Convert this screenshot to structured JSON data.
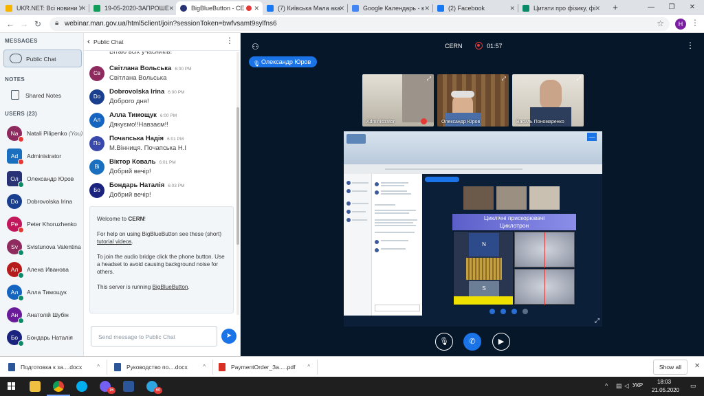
{
  "browser": {
    "tabs": [
      {
        "label": "UKR.NET: Всі новини У",
        "color": "#f4b400"
      },
      {
        "label": "19-05-2020-ЗАПРОШЕ",
        "color": "#0f9d58"
      },
      {
        "label": "BigBlueButton - CE",
        "color": "#283274"
      },
      {
        "label": "(7) Київська Мала ака",
        "color": "#1877f2"
      },
      {
        "label": "Google Календарь - к",
        "color": "#4285f4"
      },
      {
        "label": "(2) Facebook",
        "color": "#1877f2"
      },
      {
        "label": "Цитати про фізику, фі",
        "color": "#0b8a6a"
      }
    ],
    "url": "webinar.man.gov.ua/html5client/join?sessionToken=bwfvsamt9sylfns6",
    "profile_initial": "H",
    "new_tab": "+",
    "win_min": "—",
    "win_max": "❐",
    "win_close": "✕"
  },
  "sidebar": {
    "messages_title": "MESSAGES",
    "public_chat": "Public Chat",
    "notes_title": "NOTES",
    "shared_notes": "Shared Notes",
    "users_title": "USERS (23)",
    "users": [
      {
        "initials": "Na",
        "name": "Natali Pilipenko",
        "suffix": "(You)",
        "color": "#8e2a5d",
        "badge": "#e53935"
      },
      {
        "initials": "Ad",
        "name": "Administrator",
        "suffix": "",
        "color": "#1a6fbf",
        "badge": "#e53935",
        "square": true
      },
      {
        "initials": "Ол",
        "name": "Олександр Юров",
        "suffix": "",
        "color": "#283274",
        "badge": "#0b8a6a",
        "square": true
      },
      {
        "initials": "Do",
        "name": "Dobrovolska Irina",
        "suffix": "",
        "color": "#1b3f8f",
        "badge": ""
      },
      {
        "initials": "Pe",
        "name": "Peter Khoruzhenko",
        "suffix": "",
        "color": "#c2185b",
        "badge": "#e53935"
      },
      {
        "initials": "Sv",
        "name": "Svistunova Valentina",
        "suffix": "",
        "color": "#8e2a5d",
        "badge": "#0b8a6a"
      },
      {
        "initials": "Ал",
        "name": "Алена Иванова",
        "suffix": "",
        "color": "#b71c1c",
        "badge": "#0b8a6a"
      },
      {
        "initials": "Ал",
        "name": "Алла Тимощук",
        "suffix": "",
        "color": "#1565c0",
        "badge": "#0b8a6a"
      },
      {
        "initials": "Ан",
        "name": "Анатолій Шубін",
        "suffix": "",
        "color": "#6a1b9a",
        "badge": "#0b8a6a"
      },
      {
        "initials": "Бо",
        "name": "Бондарь Наталія",
        "suffix": "",
        "color": "#1a237e",
        "badge": "#0b8a6a"
      }
    ]
  },
  "chat": {
    "title": "Public Chat",
    "back": "‹",
    "menu": "⋮",
    "partial_top": "Вітаю всіх учасників!",
    "messages": [
      {
        "initials": "Св",
        "name": "Світлана Вольська",
        "time": "6:00 PM",
        "text": "Світлана Вольська",
        "color": "#8e2a5d"
      },
      {
        "initials": "Do",
        "name": "Dobrovolska Irina",
        "time": "6:00 PM",
        "text": "Доброго дня!",
        "color": "#1b3f8f"
      },
      {
        "initials": "Ал",
        "name": "Алла Тимощук",
        "time": "6:00 PM",
        "text": "Дякуємо!!Навзаєм!!",
        "color": "#1565c0"
      },
      {
        "initials": "По",
        "name": "Почапська Надія",
        "time": "6:01 PM",
        "text": "М.Вінниця. Почапська Н.І",
        "color": "#3949ab"
      },
      {
        "initials": "Ві",
        "name": "Віктор Коваль",
        "time": "6:01 PM",
        "text": "Добрий вечір!",
        "color": "#1a6fbf"
      },
      {
        "initials": "Бо",
        "name": "Бондарь Наталія",
        "time": "6:03 PM",
        "text": "Добрий вечір!",
        "color": "#1a237e"
      }
    ],
    "welcome": {
      "p1_pre": "Welcome to ",
      "p1_bold": "CERN",
      "p1_post": "!",
      "p2_pre": "For help on using BigBlueButton see these (short) ",
      "p2_link": "tutorial videos",
      "p2_post": ".",
      "p3": "To join the audio bridge click the phone button. Use a headset to avoid causing background noise for others.",
      "p4_pre": "This server is running ",
      "p4_link": "BigBlueButton",
      "p4_post": "."
    },
    "input_placeholder": "Send message to Public Chat",
    "send_icon": "➤"
  },
  "main": {
    "room": "CERN",
    "timer": "01:57",
    "talker": "Олександр Юров",
    "cams": [
      {
        "name": "Administrator",
        "bg": "#c8c3b8"
      },
      {
        "name": "Олександр Юров",
        "bg": "#7a5a3e"
      },
      {
        "name": "Василь Пономаренко",
        "bg": "#d8d2c6"
      }
    ],
    "slide_title_line1": "Циклічні прискорювачі",
    "slide_title_line2": "Циклотрон",
    "magnet_n": "N",
    "magnet_s": "S",
    "minus": "—",
    "fullscreen": "⤢"
  },
  "downloads": {
    "items": [
      {
        "label": "Подготовка к за....docx",
        "color": "#2b579a"
      },
      {
        "label": "Руководство по....docx",
        "color": "#2b579a"
      },
      {
        "label": "PaymentOrder_За.....pdf",
        "color": "#d93025"
      }
    ],
    "show_all": "Show all",
    "close": "✕"
  },
  "taskbar": {
    "apps": [
      {
        "name": "start",
        "color": "#1f1f1f",
        "badge": ""
      },
      {
        "name": "search",
        "color": "#1f1f1f",
        "badge": ""
      },
      {
        "name": "task-view",
        "color": "#1f1f1f",
        "badge": ""
      },
      {
        "name": "explorer",
        "color": "#f0c040",
        "badge": ""
      },
      {
        "name": "chrome",
        "color": "#4285f4",
        "badge": ""
      },
      {
        "name": "skype",
        "color": "#00aff0",
        "badge": ""
      },
      {
        "name": "viber",
        "color": "#7360f2",
        "badge": "16"
      },
      {
        "name": "word",
        "color": "#2b579a",
        "badge": ""
      },
      {
        "name": "telegram",
        "color": "#2ca5e0",
        "badge": "60"
      }
    ],
    "lang": "УКР",
    "time": "18:03",
    "date": "21.05.2020"
  }
}
